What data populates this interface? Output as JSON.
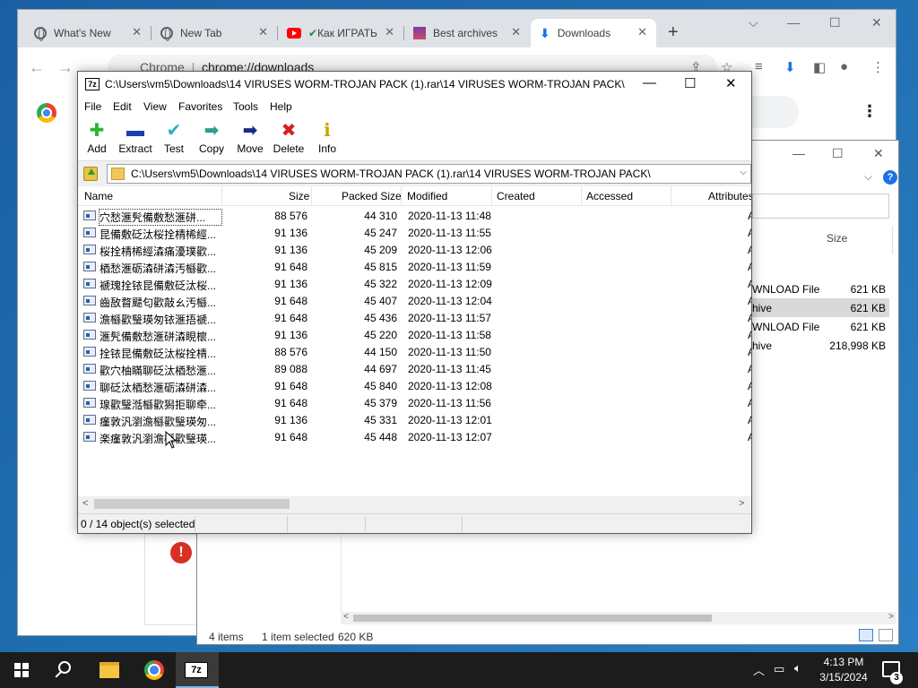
{
  "chrome": {
    "tabs": [
      {
        "title": "What's New",
        "icon": "globe-icon"
      },
      {
        "title": "New Tab",
        "icon": "globe-icon"
      },
      {
        "title": "Как ИГРАТЬ",
        "icon": "youtube-icon"
      },
      {
        "title": "Best archives",
        "icon": "archive-icon"
      },
      {
        "title": "Downloads",
        "icon": "download-icon"
      }
    ],
    "omnibox_chip": "Chrome",
    "omnibox_url": "chrome://downloads"
  },
  "explorer": {
    "column_size": "Size",
    "rows": [
      {
        "type": "WNLOAD File",
        "size": "621 KB",
        "selected": false
      },
      {
        "type": "hive",
        "size": "621 KB",
        "selected": true
      },
      {
        "type": "WNLOAD File",
        "size": "621 KB",
        "selected": false
      },
      {
        "type": "hive",
        "size": "218,998 KB",
        "selected": false
      }
    ],
    "status_items": "4 items",
    "status_selected": "1 item selected",
    "status_size": "620 KB"
  },
  "sevenzip": {
    "title": "C:\\Users\\vm5\\Downloads\\14 VIRUSES WORM-TROJAN PACK (1).rar\\14 VIRUSES WORM-TROJAN PACK\\",
    "logo": "7z",
    "menu": [
      "File",
      "Edit",
      "View",
      "Favorites",
      "Tools",
      "Help"
    ],
    "toolbar": [
      {
        "label": "Add",
        "icon": "plus-icon",
        "color": "#2fb52f",
        "glyph": "✚"
      },
      {
        "label": "Extract",
        "icon": "minus-icon",
        "color": "#1a3cb8",
        "glyph": "▬"
      },
      {
        "label": "Test",
        "icon": "check-icon",
        "color": "#2ab0c4",
        "glyph": "✔"
      },
      {
        "label": "Copy",
        "icon": "copy-arrow-icon",
        "color": "#2aa08a",
        "glyph": "➡"
      },
      {
        "label": "Move",
        "icon": "move-arrow-icon",
        "color": "#1a2a8a",
        "glyph": "➡"
      },
      {
        "label": "Delete",
        "icon": "delete-x-icon",
        "color": "#d61f1f",
        "glyph": "✖"
      },
      {
        "label": "Info",
        "icon": "info-icon",
        "color": "#c9a400",
        "glyph": "ℹ"
      }
    ],
    "address": "C:\\Users\\vm5\\Downloads\\14 VIRUSES WORM-TROJAN PACK (1).rar\\14 VIRUSES WORM-TROJAN PACK\\",
    "columns": [
      "Name",
      "Size",
      "Packed Size",
      "Modified",
      "Created",
      "Accessed",
      "Attributes"
    ],
    "files": [
      {
        "name": "穴愁滙髠備敷愁滙硑...",
        "size": "88 576",
        "packed": "44 310",
        "modified": "2020-11-13 11:48"
      },
      {
        "name": "昆備敷砭汰桜拴棈桸經...",
        "size": "91 136",
        "packed": "45 247",
        "modified": "2020-11-13 11:55"
      },
      {
        "name": "桜拴棈桸經潹痛瀀璞歡...",
        "size": "91 136",
        "packed": "45 209",
        "modified": "2020-11-13 12:06"
      },
      {
        "name": "梄愁滙砺潹硑潹汚櫾歡...",
        "size": "91 648",
        "packed": "45 815",
        "modified": "2020-11-13 11:59"
      },
      {
        "name": "褫瑰拴铱昆備敷砭汰桜...",
        "size": "91 136",
        "packed": "45 322",
        "modified": "2020-11-13 12:09"
      },
      {
        "name": "齒敔瞀飃匂歡敲ㄠ汚櫾...",
        "size": "91 648",
        "packed": "45 407",
        "modified": "2020-11-13 12:04"
      },
      {
        "name": "澹櫾歡瑿瑛匆铱滙捂褫...",
        "size": "91 648",
        "packed": "45 436",
        "modified": "2020-11-13 11:57"
      },
      {
        "name": "滙髠備敷愁滙硑潹睍櫰...",
        "size": "91 136",
        "packed": "45 220",
        "modified": "2020-11-13 11:58"
      },
      {
        "name": "拴铱昆備敷砭汰桜拴棈...",
        "size": "88 576",
        "packed": "44 150",
        "modified": "2020-11-13 11:50"
      },
      {
        "name": "歡穴柚瞞聊砭汰梄愁滙...",
        "size": "89 088",
        "packed": "44 697",
        "modified": "2020-11-13 11:45"
      },
      {
        "name": "聊砭汰梄愁滙砺潹硑潹...",
        "size": "91 648",
        "packed": "45 840",
        "modified": "2020-11-13 12:08"
      },
      {
        "name": "瑔歡瑿湉櫾歡獡拒聊牵...",
        "size": "91 648",
        "packed": "45 379",
        "modified": "2020-11-13 11:56"
      },
      {
        "name": "瘽敦汎瀏澹櫾歡瑿瑛匆...",
        "size": "91 136",
        "packed": "45 331",
        "modified": "2020-11-13 12:01"
      },
      {
        "name": "楽瘽敦汎瀏澹櫾歡瑿瑛...",
        "size": "91 648",
        "packed": "45 448",
        "modified": "2020-11-13 12:07"
      }
    ],
    "status": "0 / 14 object(s) selected"
  },
  "taskbar": {
    "time": "4:13 PM",
    "date": "3/15/2024",
    "notifications": "3",
    "sevenzip_label": "7z"
  }
}
